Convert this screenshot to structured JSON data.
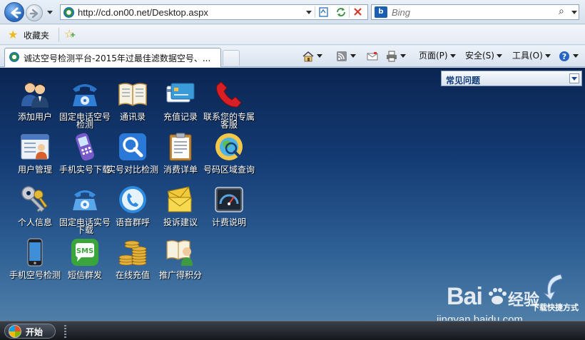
{
  "browser": {
    "address_url": "http://cd.on00.net/Desktop.aspx",
    "search_placeholder": "Bing",
    "favorites_label": "收藏夹",
    "tab_title": "诚达空号检测平台-2015年过最佳滤数据空号、...",
    "commands": {
      "page": "页面(P)",
      "safety": "安全(S)",
      "tools": "工具(O)"
    }
  },
  "desktop": {
    "faq_title": "常见问题",
    "shortcut_label": "下载快捷方式",
    "icons": [
      {
        "label": "添加用户",
        "icon": "users-icon"
      },
      {
        "label": "固定电话空号检测",
        "icon": "desk-phone-icon"
      },
      {
        "label": "通讯录",
        "icon": "address-book-icon"
      },
      {
        "label": "充值记录",
        "icon": "credit-card-icon"
      },
      {
        "label": "联系您的专属客服",
        "icon": "phone-handset-icon"
      },
      {
        "label": "用户管理",
        "icon": "user-card-icon"
      },
      {
        "label": "手机实号下载",
        "icon": "mobile-phone-icon"
      },
      {
        "label": "实号对比检测",
        "icon": "magnifier-icon"
      },
      {
        "label": "消费详单",
        "icon": "clipboard-icon"
      },
      {
        "label": "号码区域查询",
        "icon": "map-search-icon"
      },
      {
        "label": "个人信息",
        "icon": "keys-icon"
      },
      {
        "label": "固定电话实号下载",
        "icon": "phone-download-icon"
      },
      {
        "label": "语音群呼",
        "icon": "voice-call-icon"
      },
      {
        "label": "投诉建议",
        "icon": "mail-icon"
      },
      {
        "label": "计费说明",
        "icon": "gauge-icon"
      },
      {
        "label": "手机空号检测",
        "icon": "smartphone-icon"
      },
      {
        "label": "短信群发",
        "icon": "sms-icon"
      },
      {
        "label": "在线充值",
        "icon": "coins-icon"
      },
      {
        "label": "推广得积分",
        "icon": "promote-icon"
      }
    ]
  },
  "watermark": {
    "brand": "Bai",
    "brand_suffix": "经验",
    "url": "jingyan.baidu.com"
  },
  "taskbar": {
    "start_label": "开始"
  }
}
